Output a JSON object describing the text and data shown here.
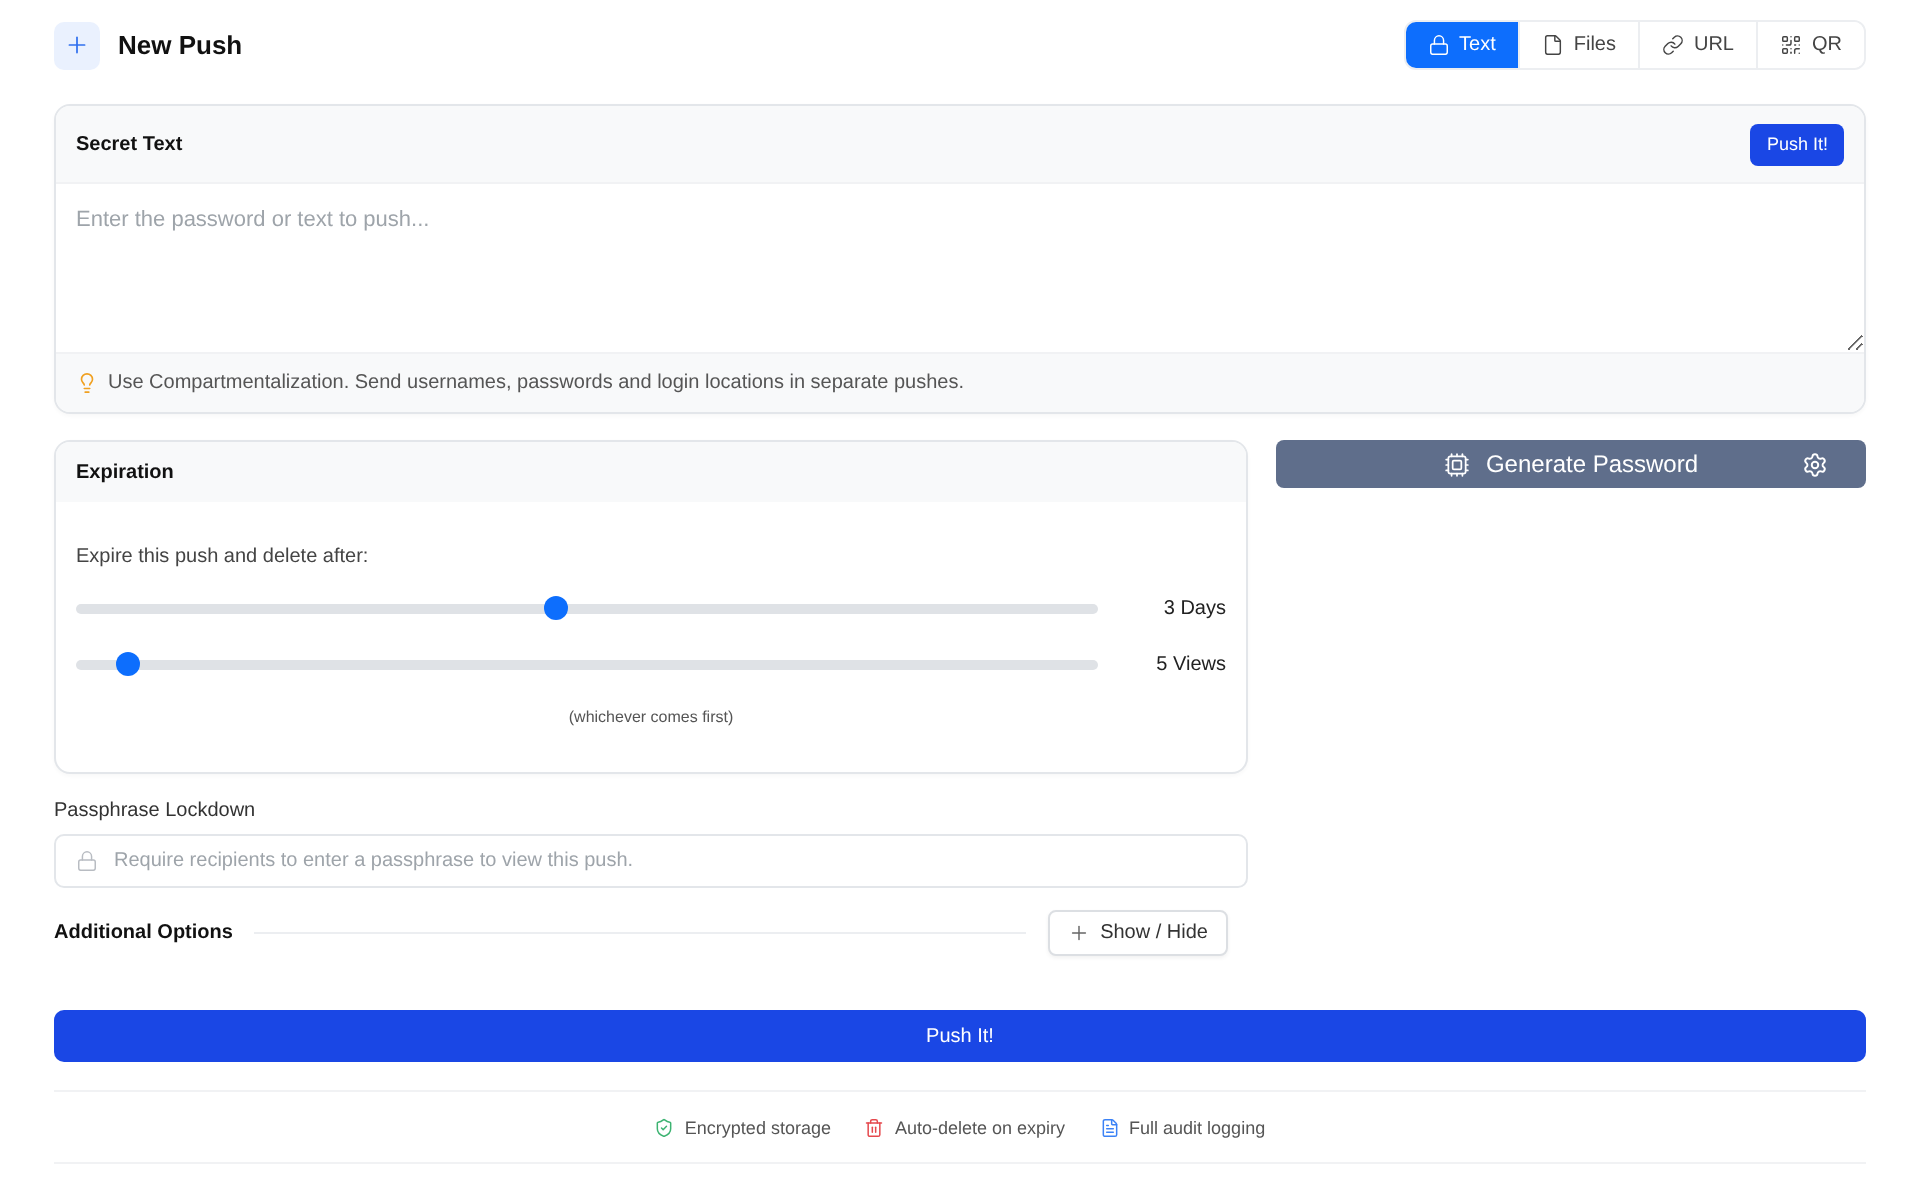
{
  "header": {
    "title": "New Push",
    "tabs": [
      {
        "label": "Text",
        "selected": true
      },
      {
        "label": "Files",
        "selected": false
      },
      {
        "label": "URL",
        "selected": false
      },
      {
        "label": "QR",
        "selected": false
      }
    ]
  },
  "secret_text": {
    "title": "Secret Text",
    "button": "Push It!",
    "placeholder": "Enter the password or text to push...",
    "hint": "Use Compartmentalization. Send usernames, passwords and login locations in separate pushes."
  },
  "expiration": {
    "title": "Expiration",
    "prompt": "Expire this push and delete after:",
    "sliders": [
      {
        "level": 0.47,
        "reading": "3 Days"
      },
      {
        "level": 0.05,
        "reading": "5 Views"
      }
    ],
    "note": "(whichever comes first)"
  },
  "generate_password": {
    "label": "Generate Password"
  },
  "passphrase": {
    "label": "Passphrase Lockdown",
    "placeholder": "Require recipients to enter a passphrase to view this push."
  },
  "additional_options": {
    "title": "Additional Options",
    "button": "Show / Hide"
  },
  "submit": {
    "label": "Push It!"
  },
  "features": [
    {
      "label": "Encrypted storage"
    },
    {
      "label": "Auto-delete on expiry"
    },
    {
      "label": "Full audit logging"
    }
  ]
}
